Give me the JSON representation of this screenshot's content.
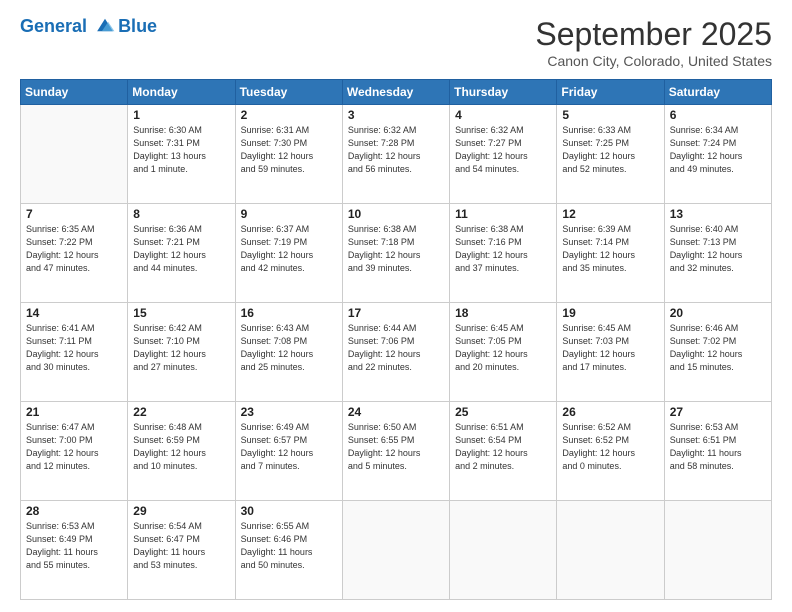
{
  "header": {
    "logo_line1": "General",
    "logo_line2": "Blue",
    "month_title": "September 2025",
    "location": "Canon City, Colorado, United States"
  },
  "weekdays": [
    "Sunday",
    "Monday",
    "Tuesday",
    "Wednesday",
    "Thursday",
    "Friday",
    "Saturday"
  ],
  "weeks": [
    [
      {
        "day": "",
        "info": ""
      },
      {
        "day": "1",
        "info": "Sunrise: 6:30 AM\nSunset: 7:31 PM\nDaylight: 13 hours\nand 1 minute."
      },
      {
        "day": "2",
        "info": "Sunrise: 6:31 AM\nSunset: 7:30 PM\nDaylight: 12 hours\nand 59 minutes."
      },
      {
        "day": "3",
        "info": "Sunrise: 6:32 AM\nSunset: 7:28 PM\nDaylight: 12 hours\nand 56 minutes."
      },
      {
        "day": "4",
        "info": "Sunrise: 6:32 AM\nSunset: 7:27 PM\nDaylight: 12 hours\nand 54 minutes."
      },
      {
        "day": "5",
        "info": "Sunrise: 6:33 AM\nSunset: 7:25 PM\nDaylight: 12 hours\nand 52 minutes."
      },
      {
        "day": "6",
        "info": "Sunrise: 6:34 AM\nSunset: 7:24 PM\nDaylight: 12 hours\nand 49 minutes."
      }
    ],
    [
      {
        "day": "7",
        "info": "Sunrise: 6:35 AM\nSunset: 7:22 PM\nDaylight: 12 hours\nand 47 minutes."
      },
      {
        "day": "8",
        "info": "Sunrise: 6:36 AM\nSunset: 7:21 PM\nDaylight: 12 hours\nand 44 minutes."
      },
      {
        "day": "9",
        "info": "Sunrise: 6:37 AM\nSunset: 7:19 PM\nDaylight: 12 hours\nand 42 minutes."
      },
      {
        "day": "10",
        "info": "Sunrise: 6:38 AM\nSunset: 7:18 PM\nDaylight: 12 hours\nand 39 minutes."
      },
      {
        "day": "11",
        "info": "Sunrise: 6:38 AM\nSunset: 7:16 PM\nDaylight: 12 hours\nand 37 minutes."
      },
      {
        "day": "12",
        "info": "Sunrise: 6:39 AM\nSunset: 7:14 PM\nDaylight: 12 hours\nand 35 minutes."
      },
      {
        "day": "13",
        "info": "Sunrise: 6:40 AM\nSunset: 7:13 PM\nDaylight: 12 hours\nand 32 minutes."
      }
    ],
    [
      {
        "day": "14",
        "info": "Sunrise: 6:41 AM\nSunset: 7:11 PM\nDaylight: 12 hours\nand 30 minutes."
      },
      {
        "day": "15",
        "info": "Sunrise: 6:42 AM\nSunset: 7:10 PM\nDaylight: 12 hours\nand 27 minutes."
      },
      {
        "day": "16",
        "info": "Sunrise: 6:43 AM\nSunset: 7:08 PM\nDaylight: 12 hours\nand 25 minutes."
      },
      {
        "day": "17",
        "info": "Sunrise: 6:44 AM\nSunset: 7:06 PM\nDaylight: 12 hours\nand 22 minutes."
      },
      {
        "day": "18",
        "info": "Sunrise: 6:45 AM\nSunset: 7:05 PM\nDaylight: 12 hours\nand 20 minutes."
      },
      {
        "day": "19",
        "info": "Sunrise: 6:45 AM\nSunset: 7:03 PM\nDaylight: 12 hours\nand 17 minutes."
      },
      {
        "day": "20",
        "info": "Sunrise: 6:46 AM\nSunset: 7:02 PM\nDaylight: 12 hours\nand 15 minutes."
      }
    ],
    [
      {
        "day": "21",
        "info": "Sunrise: 6:47 AM\nSunset: 7:00 PM\nDaylight: 12 hours\nand 12 minutes."
      },
      {
        "day": "22",
        "info": "Sunrise: 6:48 AM\nSunset: 6:59 PM\nDaylight: 12 hours\nand 10 minutes."
      },
      {
        "day": "23",
        "info": "Sunrise: 6:49 AM\nSunset: 6:57 PM\nDaylight: 12 hours\nand 7 minutes."
      },
      {
        "day": "24",
        "info": "Sunrise: 6:50 AM\nSunset: 6:55 PM\nDaylight: 12 hours\nand 5 minutes."
      },
      {
        "day": "25",
        "info": "Sunrise: 6:51 AM\nSunset: 6:54 PM\nDaylight: 12 hours\nand 2 minutes."
      },
      {
        "day": "26",
        "info": "Sunrise: 6:52 AM\nSunset: 6:52 PM\nDaylight: 12 hours\nand 0 minutes."
      },
      {
        "day": "27",
        "info": "Sunrise: 6:53 AM\nSunset: 6:51 PM\nDaylight: 11 hours\nand 58 minutes."
      }
    ],
    [
      {
        "day": "28",
        "info": "Sunrise: 6:53 AM\nSunset: 6:49 PM\nDaylight: 11 hours\nand 55 minutes."
      },
      {
        "day": "29",
        "info": "Sunrise: 6:54 AM\nSunset: 6:47 PM\nDaylight: 11 hours\nand 53 minutes."
      },
      {
        "day": "30",
        "info": "Sunrise: 6:55 AM\nSunset: 6:46 PM\nDaylight: 11 hours\nand 50 minutes."
      },
      {
        "day": "",
        "info": ""
      },
      {
        "day": "",
        "info": ""
      },
      {
        "day": "",
        "info": ""
      },
      {
        "day": "",
        "info": ""
      }
    ]
  ]
}
